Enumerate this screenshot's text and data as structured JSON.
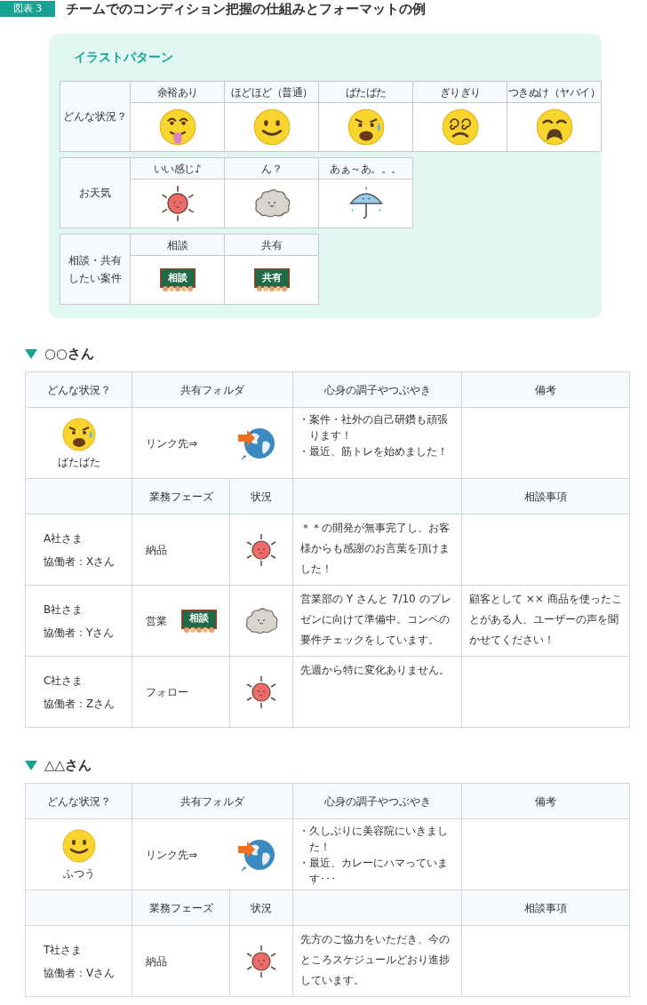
{
  "figure": {
    "badge": "図表 3",
    "title": "チームでのコンディション把握の仕組みとフォーマットの例"
  },
  "patterns": {
    "title": "イラストパターン",
    "groups": [
      {
        "label": "どんな状況？",
        "items": [
          {
            "label": "余裕あり",
            "kind": "relaxed"
          },
          {
            "label": "ほどほど（普通）",
            "kind": "normal"
          },
          {
            "label": "ばたばた",
            "kind": "busy"
          },
          {
            "label": "ぎりぎり",
            "kind": "dizzy"
          },
          {
            "label": "つきぬけ（ヤバイ）",
            "kind": "panic"
          }
        ]
      },
      {
        "label": "お天気",
        "items": [
          {
            "label": "いい感じ♪",
            "kind": "sun"
          },
          {
            "label": "ん？",
            "kind": "cloud"
          },
          {
            "label": "あぁ～あ。。。",
            "kind": "umbrella"
          }
        ]
      },
      {
        "label_lines": [
          "相談・共有",
          "したい案件"
        ],
        "items": [
          {
            "label": "相談",
            "kind": "board",
            "board_text": "相談"
          },
          {
            "label": "共有",
            "kind": "board",
            "board_text": "共有"
          }
        ]
      }
    ]
  },
  "members": [
    {
      "name": "○○さん",
      "header": {
        "status": "どんな状況？",
        "folder": "共有フォルダ",
        "mind": "心身の調子やつぶやき",
        "memo": "備考"
      },
      "status": {
        "kind": "busy",
        "label": "ばたばた"
      },
      "link_label": "リンク先⇒",
      "notes": [
        "・案件・社外の自己研鑽も頑張ります！",
        "・最近、筋トレを始めました！"
      ],
      "sub_header": {
        "phase": "業務フェーズ",
        "weather": "状況",
        "consult": "相談事項"
      },
      "rows": [
        {
          "client": "A社さま",
          "partner": "協働者：Xさん",
          "phase": "納品",
          "weather": {
            "kind": "sun"
          },
          "comment": "＊＊の開発が無事完了し、お客様からも感謝のお言葉を頂けました！"
        },
        {
          "client": "B社さま",
          "partner": "協働者：Yさん",
          "phase": "営業",
          "phase_board": "相談",
          "weather": {
            "kind": "cloud"
          },
          "comment": "営業部の Y さんと 7/10 のプレゼンに向けて準備中。コンペの要件チェックをしています。",
          "consult": "顧客として ×× 商品を使ったことがある人、ユーザーの声を聞かせてください！"
        },
        {
          "client": "C社さま",
          "partner": "協働者：Zさん",
          "phase": "フォロー",
          "weather": {
            "kind": "sun"
          },
          "comment": "先週から特に変化ありません。"
        }
      ]
    },
    {
      "name": "△△さん",
      "header": {
        "status": "どんな状況？",
        "folder": "共有フォルダ",
        "mind": "心身の調子やつぶやき",
        "memo": "備考"
      },
      "status": {
        "kind": "normal",
        "label": "ふつう"
      },
      "link_label": "リンク先⇒",
      "notes": [
        "・久しぶりに美容院にいきました！",
        "・最近、カレーにハマっています･･･"
      ],
      "sub_header": {
        "phase": "業務フェーズ",
        "weather": "状況",
        "consult": "相談事項"
      },
      "rows": [
        {
          "client": "T社さま",
          "partner": "協働者：Vさん",
          "phase": "納品",
          "weather": {
            "kind": "sun"
          },
          "comment": "先方のご協力をいただき、今のところスケジュールどおり進捗しています。"
        }
      ]
    }
  ]
}
